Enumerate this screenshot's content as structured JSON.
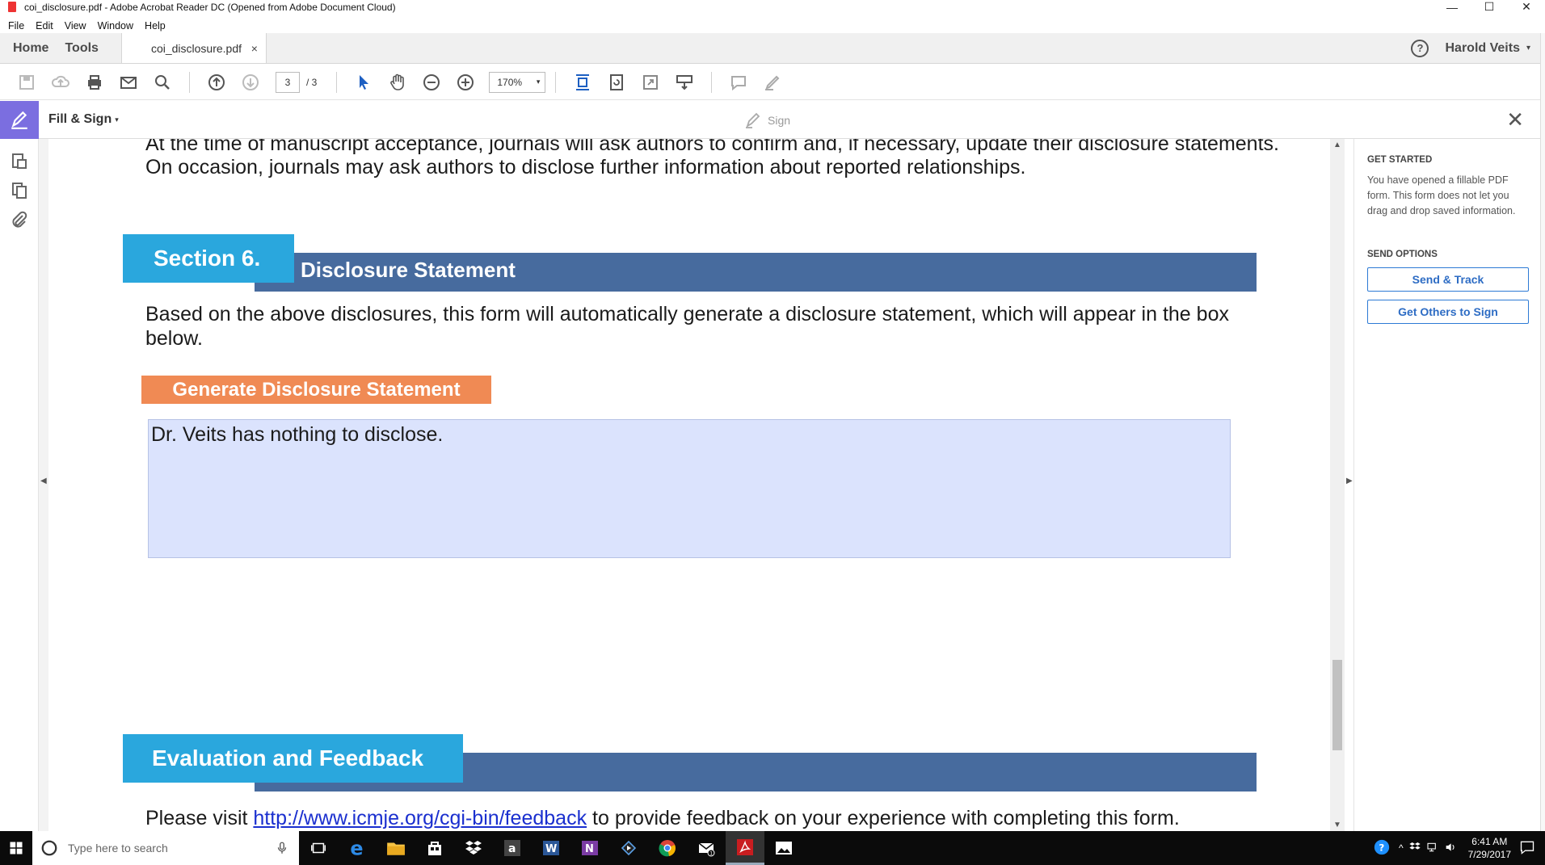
{
  "window": {
    "title": "coi_disclosure.pdf - Adobe Acrobat Reader DC (Opened from Adobe Document Cloud)",
    "minimize": "—",
    "maximize": "☐",
    "close": "✕"
  },
  "menu": [
    "File",
    "Edit",
    "View",
    "Window",
    "Help"
  ],
  "tabs": {
    "home": "Home",
    "tools": "Tools",
    "document": "coi_disclosure.pdf",
    "close": "×"
  },
  "user": {
    "help": "?",
    "name": "Harold Veits",
    "caret": "▾"
  },
  "toolbar": {
    "page_current": "3",
    "page_total": "/ 3",
    "zoom": "170%",
    "zoom_caret": "▾"
  },
  "fill_sign": {
    "label": "Fill & Sign",
    "caret": "▾",
    "sign": "Sign",
    "close": "✕"
  },
  "document": {
    "para1_line1": "At the time of manuscript acceptance, journals will ask authors to confirm and, if necessary, update their disclosure statements.",
    "para1_line2": "On occasion, journals may ask authors to disclose further information about reported relationships.",
    "section6_tab": "Section 6.",
    "section6_title": "Disclosure Statement",
    "para2_line1": "Based on the above disclosures, this form will automatically generate a disclosure statement, which will appear in the box",
    "para2_line2": "below.",
    "generate_button": "Generate Disclosure Statement",
    "disclosure_text": "Dr. Veits has nothing to disclose.",
    "eval_tab": "Evaluation and Feedback",
    "feedback_pre": "Please visit ",
    "feedback_link": "http://www.icmje.org/cgi-bin/feedback",
    "feedback_post": " to provide feedback on your experience with completing this form."
  },
  "right_panel": {
    "get_started_heading": "GET STARTED",
    "get_started_text": "You have opened a fillable PDF form. This form does not let you drag and drop saved information.",
    "send_options_heading": "SEND OPTIONS",
    "send_track": "Send & Track",
    "get_others_sign": "Get Others to Sign"
  },
  "taskbar": {
    "search_placeholder": "Type here to search",
    "time": "6:41 AM",
    "date": "7/29/2017",
    "notification_count": "1"
  },
  "colors": {
    "section_tab": "#2aa7dd",
    "section_bar": "#476b9e",
    "generate_button": "#f08a54",
    "disclosure_box": "#dbe3fd",
    "fill_sign_accent": "#7b6ee0",
    "link": "#1a2fcf"
  }
}
